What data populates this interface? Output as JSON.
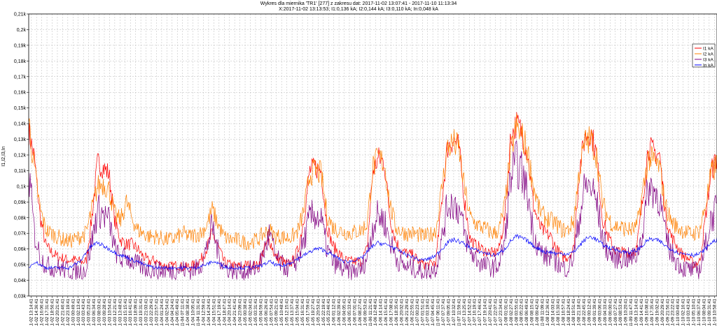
{
  "chart_data": {
    "type": "line",
    "title": "Wykres dla miernika 'TR1' [277] z zakresu dat: 2017-11-02 13:07:41 - 2017-11-10 11:13:34",
    "subtitle": "X:2017-11-02 13:13:53; I1:0,136 kA; I2:0,144 kA; I3:0,110 kA; In:0,048 kA",
    "ylabel": "I1,I2,I3,In",
    "xlabel": "",
    "ylim": [
      0.03,
      0.21
    ],
    "yticks": [
      "0,03k",
      "0,04k",
      "0,05k",
      "0,06k",
      "0,07k",
      "0,08k",
      "0,09k",
      "0,1k",
      "0,11k",
      "0,12k",
      "0,13k",
      "0,14k",
      "0,15k",
      "0,16k",
      "0,17k",
      "0,18k",
      "0,19k",
      "0,2k",
      "0,21k"
    ],
    "grid": true,
    "legend_position": "top-right",
    "xticks": [
      "11-02 13:14:41",
      "11-02 14:36:41",
      "11-02 16:06:41",
      "11-02 17:31:41",
      "11-02 18:56:41",
      "11-02 20:21:41",
      "11-02 21:46:41",
      "11-02 23:19:41",
      "11-03 00:49:41",
      "11-03 02:13:41",
      "11-03 03:43:41",
      "11-03 05:23:41",
      "11-03 06:34:41",
      "11-03 08:03:41",
      "11-03 09:28:41",
      "11-03 10:54:41",
      "11-03 12:21:41",
      "11-03 13:48:41",
      "11-03 15:15:41",
      "11-03 16:41:41",
      "11-03 18:09:41",
      "11-03 19:31:41",
      "11-03 21:03:41",
      "11-03 22:29:41",
      "11-03 23:57:41",
      "11-04 01:24:41",
      "11-04 02:54:41",
      "11-04 04:24:41",
      "11-04 05:49:41",
      "11-04 07:11:41",
      "11-04 08:38:41",
      "11-04 10:05:41",
      "11-04 11:31:41",
      "11-04 12:59:41",
      "11-04 14:24:41",
      "11-04 15:51:41",
      "11-04 17:19:41",
      "11-04 18:47:41",
      "11-04 20:14:41",
      "11-04 21:41:41",
      "11-04 23:09:41",
      "11-05 00:38:41",
      "11-05 02:04:41",
      "11-05 03:31:41",
      "11-05 04:59:41",
      "11-05 06:26:41",
      "11-05 07:54:41",
      "11-05 09:21:41",
      "11-05 10:48:41",
      "11-05 12:15:41",
      "11-05 13:37:41",
      "11-05 15:04:41",
      "11-05 16:31:41",
      "11-05 17:59:41",
      "11-05 19:27:41",
      "11-05 20:53:41",
      "11-05 22:19:41",
      "11-05 23:46:41",
      "11-06 01:12:41",
      "11-06 02:39:41",
      "11-06 04:05:41",
      "11-06 05:33:41",
      "11-06 07:01:41",
      "11-06 08:27:41",
      "11-06 09:53:41",
      "11-06 11:21:41",
      "11-06 12:48:41",
      "11-06 14:14:41",
      "11-06 15:41:41",
      "11-06 17:08:41",
      "11-06 18:35:41",
      "11-06 20:02:41",
      "11-06 21:29:41",
      "11-06 22:55:41",
      "11-07 00:23:41",
      "11-07 01:51:41",
      "11-07 03:19:41",
      "11-07 04:45:41",
      "11-07 06:11:41",
      "11-07 07:37:41",
      "11-07 09:05:41",
      "11-07 10:32:41",
      "11-07 11:59:41",
      "11-07 13:25:41",
      "11-07 14:52:41",
      "11-07 16:19:41",
      "11-07 17:46:41",
      "11-07 19:14:41",
      "11-07 20:41:41",
      "11-07 22:07:41",
      "11-07 23:34:41",
      "11-08 01:01:41",
      "11-08 02:27:41",
      "11-08 03:55:41",
      "11-08 05:22:41",
      "11-08 06:49:41",
      "11-08 08:15:41",
      "11-08 09:42:41",
      "11-08 11:09:41",
      "11-08 12:36:41",
      "11-08 14:03:41",
      "11-08 15:30:41",
      "11-08 16:57:41",
      "11-08 18:24:41",
      "11-08 19:51:41",
      "11-08 21:18:41",
      "11-08 22:45:41",
      "11-09 00:12:41",
      "11-09 01:39:41",
      "11-09 03:06:41",
      "11-09 04:33:41",
      "11-09 06:00:41",
      "11-09 07:27:41",
      "11-09 08:53:41",
      "11-09 10:20:41",
      "11-09 11:47:41",
      "11-09 13:14:41",
      "11-09 14:41:41",
      "11-09 16:08:41",
      "11-09 17:35:41",
      "11-09 19:02:41",
      "11-09 20:29:41",
      "11-09 21:56:41",
      "11-09 23:22:41",
      "11-10 00:49:41",
      "11-10 02:16:41",
      "11-10 03:43:41",
      "11-10 05:10:41",
      "11-10 06:37:41",
      "11-10 08:04:41",
      "11-10 09:31:41",
      "11-10 10:58:41"
    ],
    "series": [
      {
        "name": "I1 kA",
        "color": "#ff0000",
        "values": [
          0.135,
          0.118,
          0.08,
          0.062,
          0.058,
          0.055,
          0.054,
          0.053,
          0.053,
          0.052,
          0.052,
          0.08,
          0.115,
          0.112,
          0.108,
          0.078,
          0.066,
          0.063,
          0.063,
          0.06,
          0.055,
          0.052,
          0.053,
          0.05,
          0.049,
          0.049,
          0.05,
          0.048,
          0.049,
          0.05,
          0.053,
          0.06,
          0.07,
          0.062,
          0.052,
          0.05,
          0.049,
          0.049,
          0.05,
          0.05,
          0.049,
          0.06,
          0.066,
          0.055,
          0.053,
          0.05,
          0.052,
          0.06,
          0.08,
          0.11,
          0.112,
          0.11,
          0.075,
          0.062,
          0.058,
          0.053,
          0.052,
          0.052,
          0.052,
          0.06,
          0.11,
          0.118,
          0.115,
          0.08,
          0.065,
          0.059,
          0.057,
          0.056,
          0.052,
          0.05,
          0.05,
          0.052,
          0.09,
          0.125,
          0.13,
          0.125,
          0.09,
          0.066,
          0.062,
          0.06,
          0.058,
          0.057,
          0.06,
          0.08,
          0.13,
          0.14,
          0.135,
          0.12,
          0.088,
          0.075,
          0.07,
          0.068,
          0.06,
          0.055,
          0.055,
          0.06,
          0.11,
          0.132,
          0.135,
          0.12,
          0.08,
          0.068,
          0.06,
          0.058,
          0.058,
          0.058,
          0.06,
          0.09,
          0.125,
          0.122,
          0.12,
          0.082,
          0.068,
          0.062,
          0.056,
          0.054,
          0.05,
          0.052,
          0.08,
          0.11,
          0.118
        ]
      },
      {
        "name": "I2 kA",
        "color": "#ff8000",
        "values": [
          0.142,
          0.11,
          0.085,
          0.072,
          0.07,
          0.068,
          0.066,
          0.065,
          0.066,
          0.068,
          0.07,
          0.085,
          0.1,
          0.102,
          0.098,
          0.082,
          0.078,
          0.09,
          0.08,
          0.072,
          0.07,
          0.068,
          0.068,
          0.067,
          0.066,
          0.066,
          0.068,
          0.07,
          0.068,
          0.069,
          0.07,
          0.075,
          0.085,
          0.076,
          0.068,
          0.066,
          0.066,
          0.065,
          0.064,
          0.065,
          0.066,
          0.07,
          0.072,
          0.068,
          0.068,
          0.067,
          0.068,
          0.072,
          0.085,
          0.108,
          0.11,
          0.108,
          0.082,
          0.074,
          0.072,
          0.071,
          0.07,
          0.071,
          0.072,
          0.076,
          0.112,
          0.118,
          0.115,
          0.088,
          0.074,
          0.071,
          0.07,
          0.07,
          0.069,
          0.068,
          0.069,
          0.072,
          0.098,
          0.124,
          0.128,
          0.124,
          0.098,
          0.08,
          0.076,
          0.074,
          0.072,
          0.07,
          0.072,
          0.088,
          0.12,
          0.138,
          0.132,
          0.122,
          0.1,
          0.085,
          0.08,
          0.078,
          0.076,
          0.072,
          0.072,
          0.078,
          0.11,
          0.128,
          0.13,
          0.12,
          0.09,
          0.08,
          0.075,
          0.074,
          0.073,
          0.072,
          0.074,
          0.095,
          0.118,
          0.116,
          0.112,
          0.088,
          0.078,
          0.074,
          0.072,
          0.07,
          0.07,
          0.072,
          0.088,
          0.108,
          0.114
        ]
      },
      {
        "name": "I3 kA",
        "color": "#800080",
        "values": [
          0.11,
          0.07,
          0.055,
          0.05,
          0.048,
          0.048,
          0.047,
          0.046,
          0.046,
          0.046,
          0.047,
          0.065,
          0.085,
          0.082,
          0.078,
          0.06,
          0.053,
          0.055,
          0.052,
          0.05,
          0.048,
          0.047,
          0.047,
          0.046,
          0.046,
          0.046,
          0.047,
          0.047,
          0.046,
          0.047,
          0.05,
          0.06,
          0.075,
          0.058,
          0.049,
          0.047,
          0.046,
          0.046,
          0.046,
          0.047,
          0.048,
          0.058,
          0.07,
          0.055,
          0.05,
          0.048,
          0.048,
          0.055,
          0.065,
          0.08,
          0.082,
          0.078,
          0.06,
          0.052,
          0.049,
          0.046,
          0.046,
          0.046,
          0.047,
          0.055,
          0.075,
          0.082,
          0.078,
          0.065,
          0.055,
          0.05,
          0.048,
          0.048,
          0.046,
          0.046,
          0.046,
          0.048,
          0.065,
          0.088,
          0.09,
          0.085,
          0.07,
          0.058,
          0.054,
          0.05,
          0.049,
          0.048,
          0.05,
          0.065,
          0.105,
          0.115,
          0.108,
          0.095,
          0.07,
          0.06,
          0.055,
          0.055,
          0.052,
          0.048,
          0.048,
          0.055,
          0.08,
          0.1,
          0.1,
          0.09,
          0.068,
          0.058,
          0.055,
          0.054,
          0.054,
          0.054,
          0.056,
          0.07,
          0.1,
          0.098,
          0.092,
          0.068,
          0.058,
          0.052,
          0.048,
          0.047,
          0.046,
          0.047,
          0.062,
          0.08,
          0.085
        ]
      },
      {
        "name": "In kA",
        "color": "#0000ff",
        "values": [
          0.048,
          0.052,
          0.05,
          0.048,
          0.048,
          0.048,
          0.048,
          0.048,
          0.05,
          0.052,
          0.058,
          0.062,
          0.064,
          0.062,
          0.06,
          0.058,
          0.056,
          0.055,
          0.053,
          0.052,
          0.05,
          0.049,
          0.048,
          0.048,
          0.048,
          0.048,
          0.048,
          0.048,
          0.048,
          0.048,
          0.049,
          0.05,
          0.052,
          0.051,
          0.049,
          0.048,
          0.048,
          0.048,
          0.048,
          0.048,
          0.049,
          0.05,
          0.052,
          0.05,
          0.049,
          0.05,
          0.052,
          0.054,
          0.056,
          0.058,
          0.06,
          0.06,
          0.058,
          0.056,
          0.054,
          0.052,
          0.052,
          0.053,
          0.054,
          0.058,
          0.062,
          0.064,
          0.063,
          0.062,
          0.06,
          0.058,
          0.056,
          0.055,
          0.053,
          0.053,
          0.054,
          0.056,
          0.06,
          0.064,
          0.066,
          0.065,
          0.063,
          0.061,
          0.059,
          0.058,
          0.057,
          0.056,
          0.057,
          0.06,
          0.065,
          0.068,
          0.067,
          0.065,
          0.062,
          0.06,
          0.058,
          0.058,
          0.057,
          0.057,
          0.057,
          0.058,
          0.062,
          0.066,
          0.068,
          0.066,
          0.063,
          0.061,
          0.06,
          0.059,
          0.058,
          0.058,
          0.059,
          0.062,
          0.066,
          0.066,
          0.065,
          0.062,
          0.06,
          0.058,
          0.057,
          0.057,
          0.056,
          0.057,
          0.06,
          0.064,
          0.066
        ]
      }
    ]
  }
}
